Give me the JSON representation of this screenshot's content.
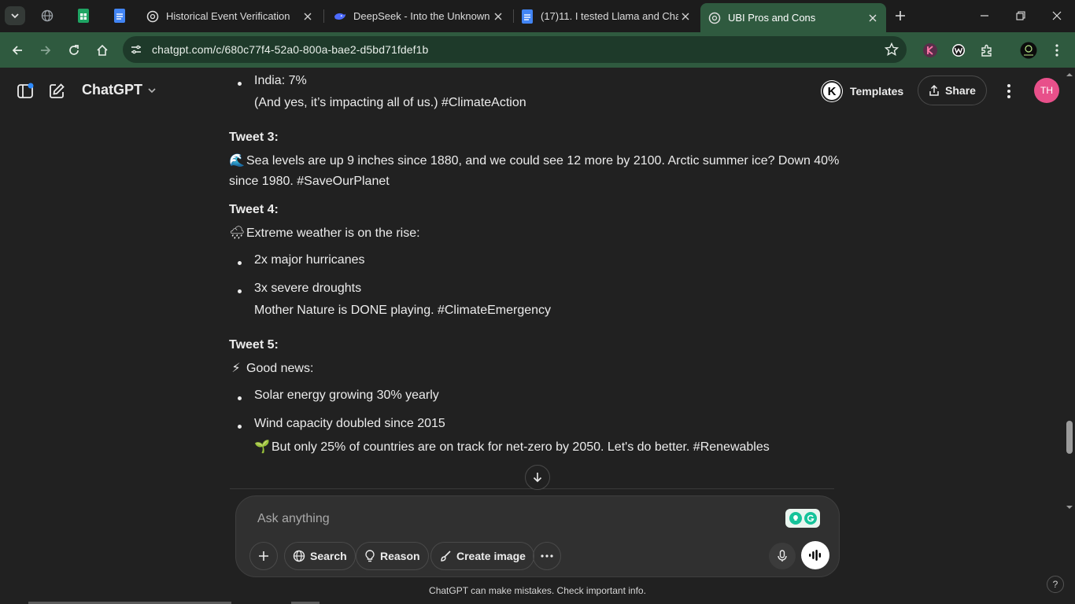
{
  "browser": {
    "tabs": [
      {
        "title": "Historical Event Verification"
      },
      {
        "title": "DeepSeek - Into the Unknown"
      },
      {
        "title": "(17)11. I tested Llama and ChatGPT"
      },
      {
        "title": "UBI Pros and Cons",
        "active": true
      }
    ],
    "url": "chatgpt.com/c/680c77f4-52a0-800a-bae2-d5bd71fdef1b",
    "colors": {
      "tab_active": "#2f5a3f",
      "toolbar": "#2f5a3f"
    }
  },
  "app": {
    "name": "ChatGPT",
    "templates_badge": "K",
    "templates_label": "Templates",
    "share_label": "Share",
    "avatar_initials": "TH"
  },
  "conversation": {
    "lines": {
      "l1": "India: 7%",
      "l2": "(And yes, it’s impacting all of us.) #ClimateAction",
      "h3": "Tweet 3:",
      "t3a": "Sea levels are up 9 inches since 1880, and we could see 12 more by 2100. Arctic summer ice? Down 40%",
      "t3b": "since 1980. #SaveOurPlanet",
      "h4": "Tweet 4:",
      "t4": "Extreme weather is on the rise:",
      "t4b1": "2x major hurricanes",
      "t4b2": "3x severe droughts",
      "t4c": "Mother Nature is DONE playing. #ClimateEmergency",
      "h5": "Tweet 5:",
      "t5": "Good news:",
      "t5b1": "Solar energy growing 30% yearly",
      "t5b2": "Wind capacity doubled since 2015",
      "t5c": "But only 25% of countries are on track for net-zero by 2050. Let's do better. #Renewables"
    },
    "emojis": {
      "wave": "🌊",
      "storm": "🌧",
      "bolt": "⚡",
      "seedling": "🌱"
    }
  },
  "composer": {
    "placeholder": "Ask anything",
    "buttons": {
      "search": "Search",
      "reason": "Reason",
      "create_image": "Create image"
    }
  },
  "footer": {
    "disclaimer": "ChatGPT can make mistakes. Check important info.",
    "help": "?"
  }
}
